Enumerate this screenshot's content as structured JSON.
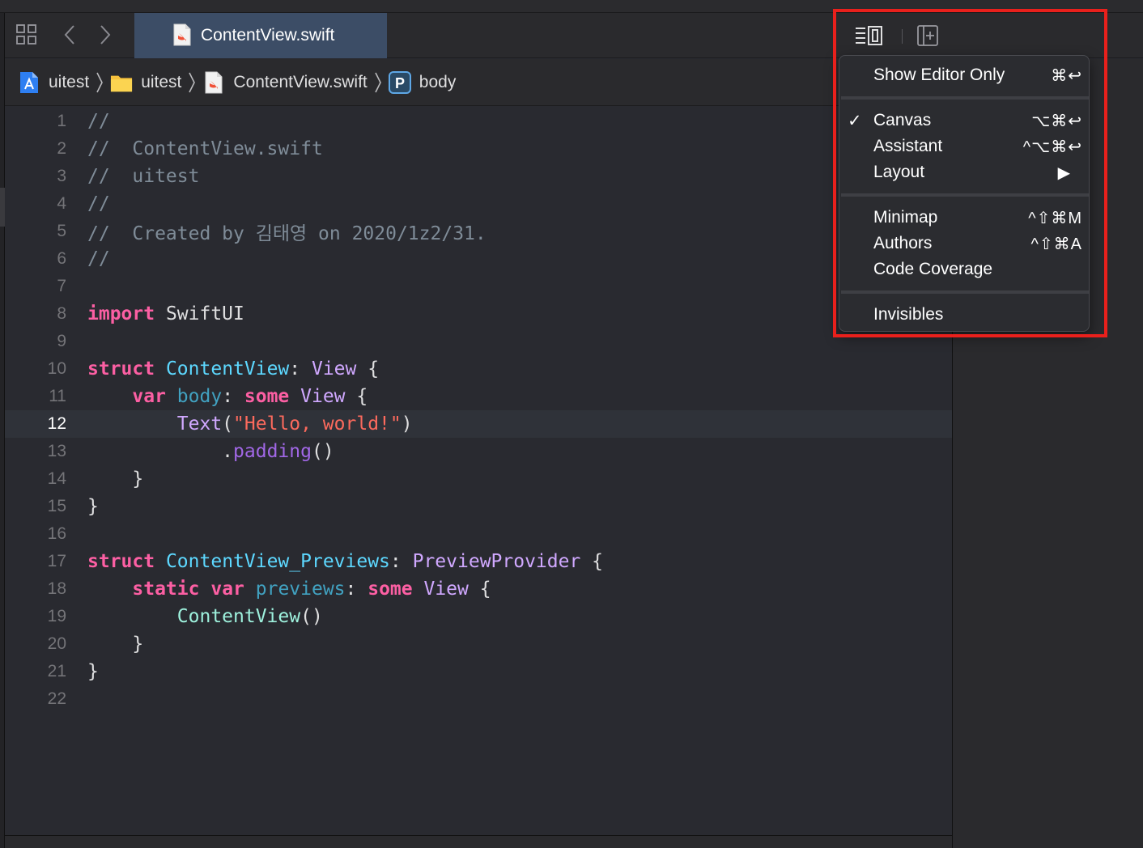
{
  "tab": {
    "title": "ContentView.swift"
  },
  "jump_bar": {
    "items": [
      {
        "label": "uitest",
        "icon": "app-project-icon"
      },
      {
        "label": "uitest",
        "icon": "folder-icon"
      },
      {
        "label": "ContentView.swift",
        "icon": "swift-file-icon"
      },
      {
        "label": "body",
        "icon": "property-icon",
        "badge": "P"
      }
    ]
  },
  "editor": {
    "current_line": 12,
    "lines": [
      {
        "n": "1"
      },
      {
        "n": "2"
      },
      {
        "n": "3"
      },
      {
        "n": "4"
      },
      {
        "n": "5"
      },
      {
        "n": "6"
      },
      {
        "n": "7"
      },
      {
        "n": "8"
      },
      {
        "n": "9"
      },
      {
        "n": "10"
      },
      {
        "n": "11"
      },
      {
        "n": "12"
      },
      {
        "n": "13"
      },
      {
        "n": "14"
      },
      {
        "n": "15"
      },
      {
        "n": "16"
      },
      {
        "n": "17"
      },
      {
        "n": "18"
      },
      {
        "n": "19"
      },
      {
        "n": "20"
      },
      {
        "n": "21"
      },
      {
        "n": "22"
      }
    ],
    "code": {
      "l1": "//",
      "l2": "//  ContentView.swift",
      "l3": "//  uitest",
      "l4": "//",
      "l5": "//  Created by 김태영 on 2020/1z2/31.",
      "l6": "//",
      "l8_kw": "import",
      "l8_rest": " SwiftUI",
      "l10_kw": "struct",
      "l10_name": "ContentView",
      "l10_colon": ": ",
      "l10_type": "View",
      "l10_brace": " {",
      "l11_kw": "var",
      "l11_name": "body",
      "l11_colon": ": ",
      "l11_some": "some",
      "l11_type": "View",
      "l11_brace": " {",
      "l12_fn": "Text",
      "l12_open": "(",
      "l12_str": "\"Hello, world!\"",
      "l12_close": ")",
      "l13_dot": ".",
      "l13_fn": "padding",
      "l13_parens": "()",
      "l14": "}",
      "l15": "}",
      "l17_kw": "struct",
      "l17_name": "ContentView_Previews",
      "l17_colon": ": ",
      "l17_type": "PreviewProvider",
      "l17_brace": " {",
      "l18_kw1": "static",
      "l18_kw2": "var",
      "l18_name": "previews",
      "l18_colon": ": ",
      "l18_some": "some",
      "l18_type": "View",
      "l18_brace": " {",
      "l19_call": "ContentView",
      "l19_parens": "()",
      "l20": "}",
      "l21": "}"
    }
  },
  "editor_menu": {
    "show_editor_only": {
      "label": "Show Editor Only",
      "shortcut": "⌘↩"
    },
    "canvas": {
      "label": "Canvas",
      "shortcut": "⌥⌘↩",
      "checked": true,
      "check_glyph": "✓"
    },
    "assistant": {
      "label": "Assistant",
      "shortcut": "^⌥⌘↩"
    },
    "layout": {
      "label": "Layout",
      "submenu_glyph": "▶"
    },
    "minimap": {
      "label": "Minimap",
      "shortcut": "^⇧⌘M"
    },
    "authors": {
      "label": "Authors",
      "shortcut": "^⇧⌘A"
    },
    "code_coverage": {
      "label": "Code Coverage"
    },
    "invisibles": {
      "label": "Invisibles"
    }
  },
  "colors": {
    "keyword": "#fc5fa3",
    "type_decl": "#5dd8ff",
    "type_ref": "#d0a8ff",
    "string": "#fc6a5d",
    "comment": "#7f8c98",
    "highlight_box": "#e9201c",
    "tab_active": "#3c4d66"
  }
}
